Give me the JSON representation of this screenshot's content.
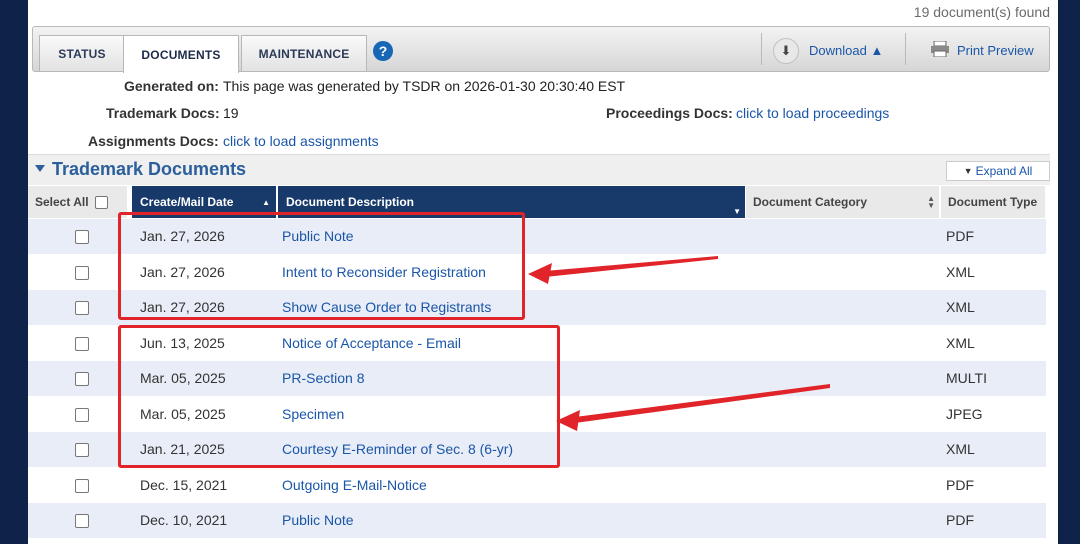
{
  "header": {
    "found_text": "19 document(s) found"
  },
  "tabs": [
    {
      "label": "STATUS"
    },
    {
      "label": "DOCUMENTS"
    },
    {
      "label": "MAINTENANCE"
    }
  ],
  "toolbar": {
    "help_glyph": "?",
    "download_label": "Download",
    "print_label": "Print Preview"
  },
  "info": {
    "generated_label": "Generated on:",
    "generated_value": "This page was generated by TSDR on 2026-01-30 20:30:40 EST",
    "tm_docs_label": "Trademark Docs:",
    "tm_docs_value": "19",
    "proceedings_label": "Proceedings Docs:",
    "proceedings_link": "click to load proceedings",
    "assignments_label": "Assignments Docs:",
    "assignments_link": "click to load assignments"
  },
  "section": {
    "title": "Trademark Documents",
    "expand_label": "Expand All"
  },
  "table": {
    "headers": {
      "select_all": "Select All",
      "date": "Create/Mail Date",
      "description": "Document Description",
      "category": "Document Category",
      "type": "Document Type"
    },
    "rows": [
      {
        "date": "Jan. 27, 2026",
        "description": "Public Note",
        "type": "PDF"
      },
      {
        "date": "Jan. 27, 2026",
        "description": "Intent to Reconsider Registration",
        "type": "XML"
      },
      {
        "date": "Jan. 27, 2026",
        "description": "Show Cause Order to Registrants",
        "type": "XML"
      },
      {
        "date": "Jun. 13, 2025",
        "description": "Notice of Acceptance - Email",
        "type": "XML"
      },
      {
        "date": "Mar. 05, 2025",
        "description": "PR-Section 8",
        "type": "MULTI"
      },
      {
        "date": "Mar. 05, 2025",
        "description": "Specimen",
        "type": "JPEG"
      },
      {
        "date": "Jan. 21, 2025",
        "description": "Courtesy E-Reminder of Sec. 8 (6-yr)",
        "type": "XML"
      },
      {
        "date": "Dec. 15, 2021",
        "description": "Outgoing E-Mail-Notice",
        "type": "PDF"
      },
      {
        "date": "Dec. 10, 2021",
        "description": "Public Note",
        "type": "PDF"
      }
    ]
  },
  "colors": {
    "accent": "#173a6a",
    "link": "#1a56a8",
    "highlight": "#e0242a"
  }
}
